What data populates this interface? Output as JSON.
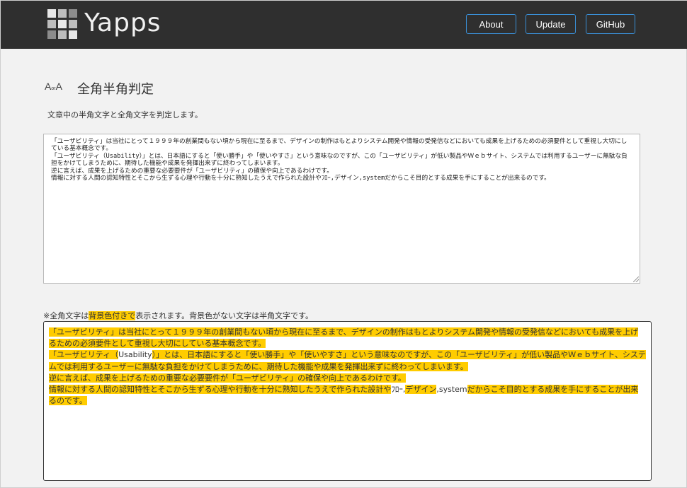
{
  "header": {
    "logo_text": "Yapps",
    "nav": [
      {
        "label": "About"
      },
      {
        "label": "Update"
      },
      {
        "label": "GitHub"
      }
    ],
    "colors": {
      "bar": "#2f2f2f",
      "button_border": "#3a8fd6"
    }
  },
  "page": {
    "icon_big_a1": "A",
    "icon_or": "or",
    "icon_big_a2": "A",
    "title": "全角半角判定",
    "description": "文章中の半角文字と全角文字を判定します。",
    "icon": "fullwidth-halfwidth-icon"
  },
  "input": {
    "value": "「ユーザビリティ」は当社にとって１９９９年の創業間もない頃から現在に至るまで、デザインの制作はもとよりシステム開発や情報の受発信などにおいても成果を上げるための必須要件として重視し大切にしている基本概念です。\n「ユーザビリティ（Usability）」とは、日本語にすると「使い勝手」や「使いやすさ」という意味なのですが、この「ユーザビリティ」が低い製品やＷｅｂサイト、システムでは利用するユーザーに無駄な負担をかけてしまうために、期待した機能や成果を発揮出来ずに終わってしまいます。\n逆に言えば、成果を上げるための重要な必要要件が「ユーザビリティ」の確保や向上であるわけです。\n情報に対する人間の認知特性とそこから生ずる心理や行動を十分に熟知したうえで作られた設計やﾌﾛｰ,デザイン,systemだからこそ目的とする成果を手にすることが出来るのです。"
  },
  "note": {
    "prefix": "※全角文字は",
    "highlight": "背景色付きで",
    "suffix": "表示されます。背景色がない文字は半角文字です。"
  },
  "result": {
    "lines": [
      [
        {
          "t": "「ユーザビリティ」は当社にとって１９９９年の創業間もない頃から現在に至るまで、デザインの制作はもとよりシステム開発や情報の受発信などにおいても成果を上げるための必須要件として重視し大切にしている基本概念です。",
          "fw": true
        }
      ],
      [
        {
          "t": "「ユーザビリティ（",
          "fw": true
        },
        {
          "t": "Usability",
          "fw": false
        },
        {
          "t": "）」とは、日本語にすると「使い勝手」や「使いやすさ」という意味なのですが、この「ユーザビリティ」が低い製品やＷｅｂサイト、システムでは利用するユーザーに無駄な負担をかけてしまうために、期待した機能や成果を発揮出来ずに終わってしまいます。",
          "fw": true
        }
      ],
      [
        {
          "t": "逆に言えば、成果を上げるための重要な必要要件が「ユーザビリティ」の確保や向上であるわけです。",
          "fw": true
        }
      ],
      [
        {
          "t": "情報に対する人間の認知特性とそこから生ずる心理や行動を十分に熟知したうえで作られた設計や",
          "fw": true
        },
        {
          "t": "ﾌﾛｰ",
          "fw": false
        },
        {
          "t": ",",
          "fw": false
        },
        {
          "t": "デザイン",
          "fw": true
        },
        {
          "t": ",system",
          "fw": false
        },
        {
          "t": "だからこそ目的とする成果を手にすることが出来るのです。",
          "fw": true
        }
      ]
    ],
    "highlight_color": "#ffcc00"
  }
}
